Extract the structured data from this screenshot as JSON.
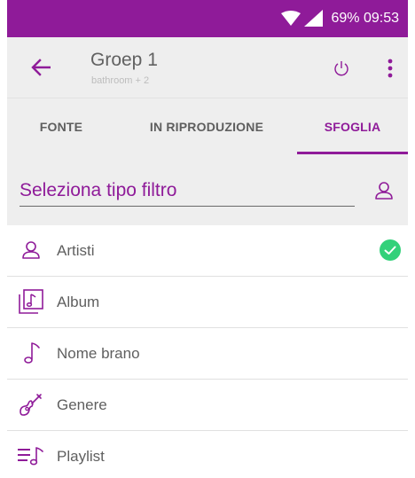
{
  "status_bar": {
    "battery_time": "69% 09:53"
  },
  "app_bar": {
    "title": "Groep 1",
    "subtitle": "bathroom + 2"
  },
  "tabs": [
    {
      "label": "FONTE"
    },
    {
      "label": "IN RIPRODUZIONE"
    },
    {
      "label": "SFOGLIA",
      "selected": true
    }
  ],
  "filter": {
    "label": "Seleziona tipo filtro"
  },
  "list": [
    {
      "label": "Artisti",
      "icon": "user-icon",
      "checked": true
    },
    {
      "label": "Album",
      "icon": "album-icon"
    },
    {
      "label": "Nome brano",
      "icon": "music-note-icon"
    },
    {
      "label": "Genere",
      "icon": "guitar-icon"
    },
    {
      "label": "Playlist",
      "icon": "playlist-icon"
    }
  ],
  "colors": {
    "accent": "#8f1b99",
    "check": "#33d17a",
    "bar_bg": "#eeeeee"
  }
}
